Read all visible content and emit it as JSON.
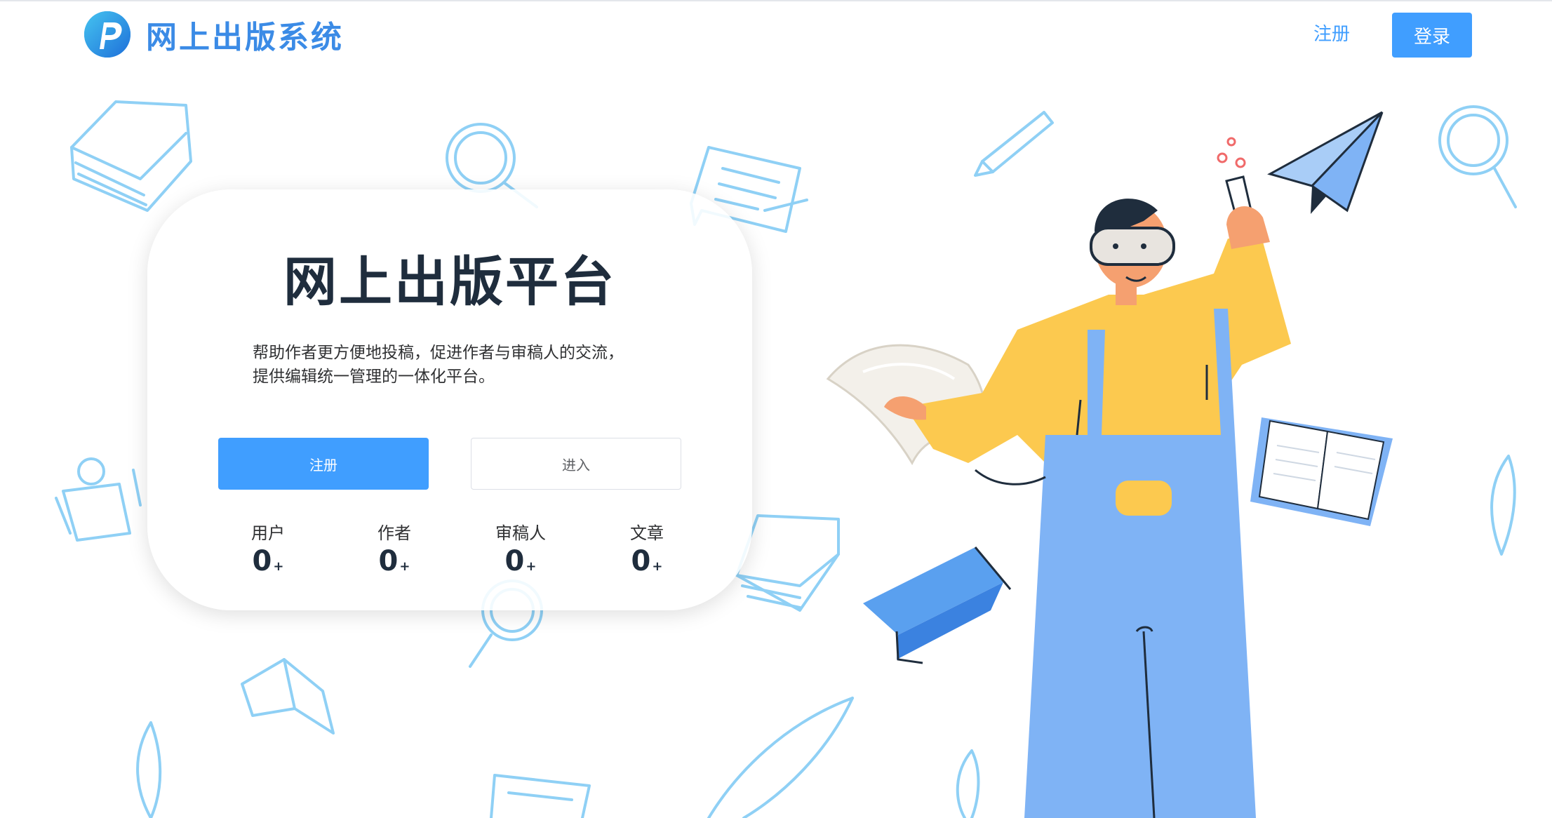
{
  "header": {
    "site_name": "网上出版系统",
    "register_label": "注册",
    "login_label": "登录",
    "logo_letter": "P"
  },
  "hero": {
    "title": "网上出版平台",
    "description_line1": "帮助作者更方便地投稿，促进作者与审稿人的交流，",
    "description_line2": "提供编辑统一管理的一体化平台。",
    "register_button": "注册",
    "enter_button": "进入"
  },
  "stats": [
    {
      "label": "用户",
      "value": "0",
      "suffix": "+"
    },
    {
      "label": "作者",
      "value": "0",
      "suffix": "+"
    },
    {
      "label": "审稿人",
      "value": "0",
      "suffix": "+"
    },
    {
      "label": "文章",
      "value": "0",
      "suffix": "+"
    }
  ],
  "colors": {
    "primary": "#409eff",
    "brand_text": "#3b8be6",
    "doodle": "#8fd0f5",
    "overalls": "#7fb3f5",
    "shirt": "#fcc94f"
  }
}
